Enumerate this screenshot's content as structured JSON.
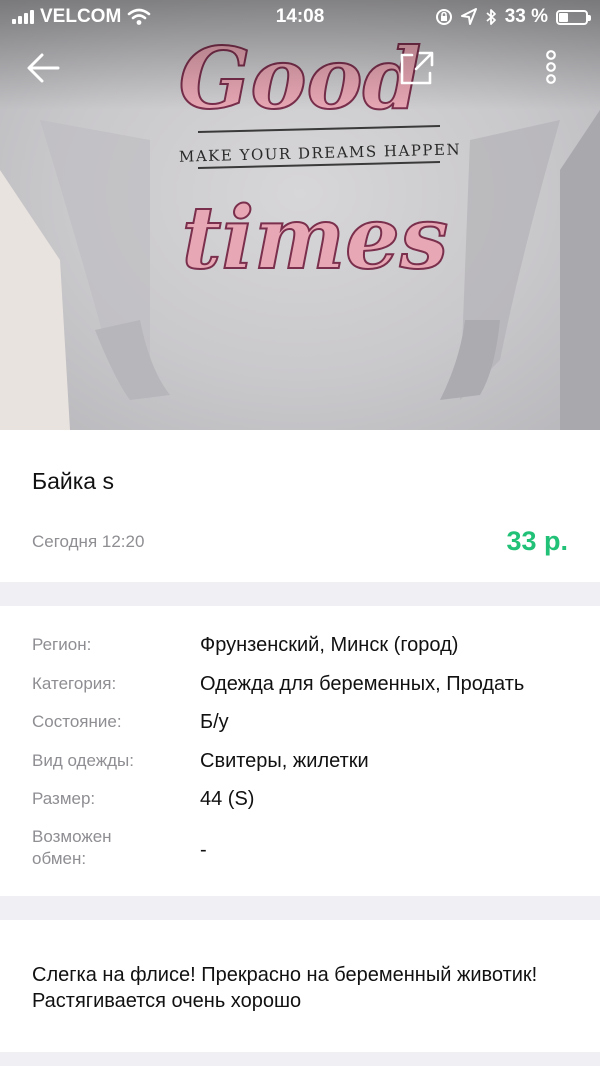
{
  "status_bar": {
    "carrier": "VELCOM",
    "time": "14:08",
    "battery": "33 %",
    "battery_level": 0.33
  },
  "photo": {
    "print_top": "Good",
    "print_middle": "MAKE YOUR DREAMS HAPPEN",
    "print_bottom": "times"
  },
  "listing": {
    "title": "Байка s",
    "date": "Сегодня 12:20",
    "price": "33 р."
  },
  "details": [
    {
      "label": "Регион:",
      "value": "Фрунзенский, Минск (город)"
    },
    {
      "label": "Категория:",
      "value": "Одежда для беременных, Продать"
    },
    {
      "label": "Состояние:",
      "value": "Б/у"
    },
    {
      "label": "Вид одежды:",
      "value": "Свитеры, жилетки"
    },
    {
      "label": "Размер:",
      "value": "44 (S)"
    },
    {
      "label": "Возможен обмен:",
      "value": "-"
    }
  ],
  "description": "Слегка на флисе! Прекрасно на беременный животик! Растягивается очень хорошо",
  "colors": {
    "price": "#21c178",
    "muted": "#8e8e93",
    "background": "#efeff4"
  }
}
